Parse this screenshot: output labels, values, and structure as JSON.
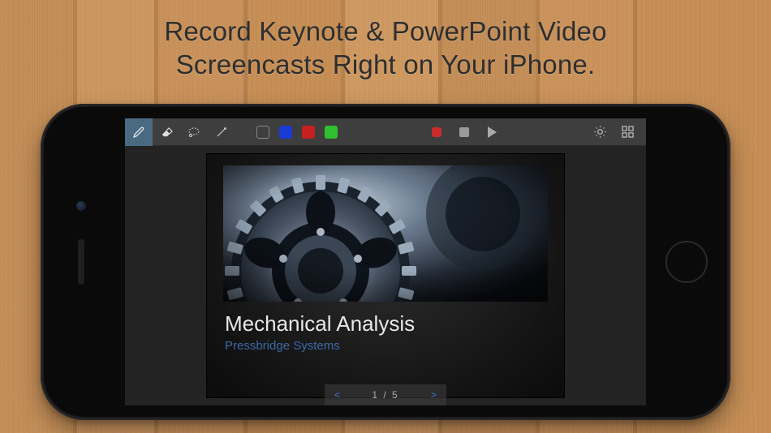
{
  "headline": {
    "line1": "Record Keynote & PowerPoint Video",
    "line2": "Screencasts Right on Your iPhone."
  },
  "toolbar": {
    "tools": [
      "pencil",
      "eraser",
      "lasso",
      "pointer"
    ],
    "colors": {
      "black_outline": "#3e3e3e",
      "blue": "#1a3ad4",
      "red": "#c82020",
      "green": "#2fbf2f"
    },
    "record_color": "#cc2b2b",
    "stop_color": "#9a9a9a",
    "play_color": "#aaaaaa"
  },
  "slide": {
    "title": "Mechanical Analysis",
    "subtitle": "Pressbridge Systems"
  },
  "pager": {
    "prev": "<",
    "count": "1 / 5",
    "next": ">"
  }
}
